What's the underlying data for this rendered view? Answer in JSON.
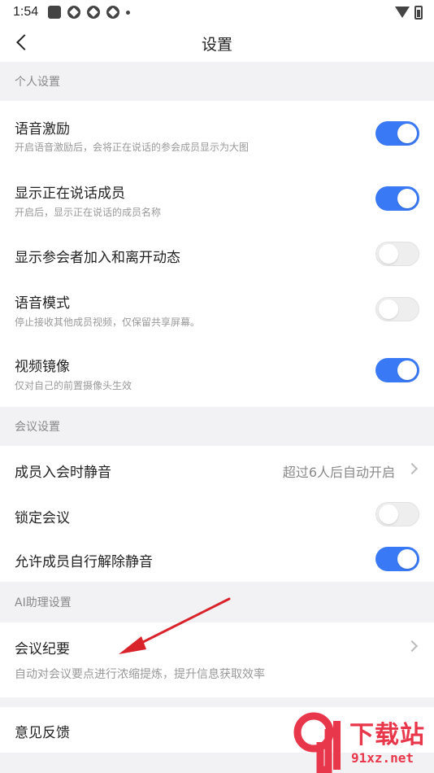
{
  "status_bar": {
    "time": "1:54"
  },
  "nav": {
    "title": "设置"
  },
  "sections": {
    "personal": "个人设置",
    "meeting": "会议设置",
    "ai": "AI助理设置"
  },
  "personal": {
    "voice_motivation": {
      "title": "语音激励",
      "desc": "开启语音激励后，会将正在说话的参会成员显示为大图",
      "enabled": true
    },
    "show_speaking": {
      "title": "显示正在说话成员",
      "desc": "开启后，显示正在说话的成员名称",
      "enabled": true
    },
    "show_join_leave": {
      "title": "显示参会者加入和离开动态",
      "enabled": false
    },
    "voice_mode": {
      "title": "语音模式",
      "desc": "停止接收其他成员视频，仅保留共享屏幕。",
      "enabled": false
    },
    "video_mirror": {
      "title": "视频镜像",
      "desc": "仅对自己的前置摄像头生效",
      "enabled": true
    }
  },
  "meeting": {
    "mute_on_join": {
      "title": "成员入会时静音",
      "value": "超过6人后自动开启"
    },
    "lock_meeting": {
      "title": "锁定会议",
      "enabled": false
    },
    "allow_unmute": {
      "title": "允许成员自行解除静音",
      "enabled": true
    }
  },
  "ai": {
    "minutes": {
      "title": "会议纪要",
      "desc": "自动对会议要点进行浓缩提炼，提升信息获取效率"
    }
  },
  "feedback": {
    "title": "意见反馈"
  },
  "watermark": {
    "brand": "下载站",
    "domain": "91xz.net"
  },
  "colors": {
    "accent": "#3a79f5",
    "annotation_arrow": "#d8232a",
    "watermark": "#e8364a"
  }
}
